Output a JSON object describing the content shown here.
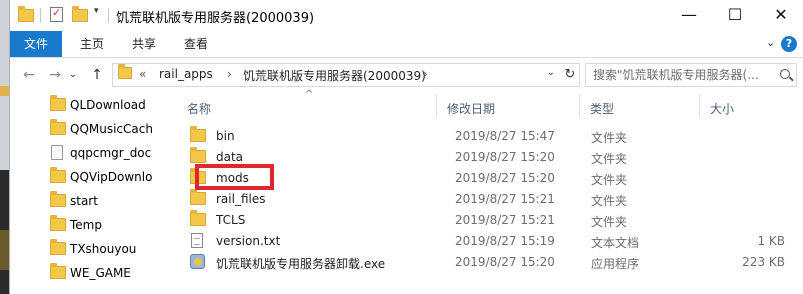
{
  "window": {
    "title": "饥荒联机版专用服务器(2000039)",
    "minimize": "—",
    "maximize": "☐",
    "close": "✕"
  },
  "ribbon": {
    "tabs": [
      "文件",
      "主页",
      "共享",
      "查看"
    ],
    "chevron": "⌄",
    "help": "?"
  },
  "nav": {
    "back": "←",
    "forward": "→",
    "recent": "⌄",
    "up": "↑",
    "crumbs": [
      "«",
      "rail_apps",
      "›",
      "饥荒联机版专用服务器(2000039)",
      "›"
    ],
    "addr_dropdown": "⌄",
    "refresh": "↻"
  },
  "search": {
    "placeholder": "搜索\"饥荒联机版专用服务器(..."
  },
  "sidebar": {
    "items": [
      {
        "label": "QLDownload",
        "icon": "folder-icon"
      },
      {
        "label": "QQMusicCach",
        "icon": "folder-icon"
      },
      {
        "label": "qqpcmgr_doc",
        "icon": "document-icon"
      },
      {
        "label": "QQVipDownlo",
        "icon": "folder-icon"
      },
      {
        "label": "start",
        "icon": "folder-icon"
      },
      {
        "label": "Temp",
        "icon": "folder-icon"
      },
      {
        "label": "TXshouyou",
        "icon": "folder-icon"
      },
      {
        "label": "WE_GAME",
        "icon": "folder-icon"
      }
    ]
  },
  "columns": {
    "name": "名称",
    "modified": "修改日期",
    "type": "类型",
    "size": "大小",
    "sort_indicator": "^"
  },
  "files": [
    {
      "name": "bin",
      "modified": "2019/8/27 15:47",
      "type": "文件夹",
      "size": "",
      "icon": "folder-icon"
    },
    {
      "name": "data",
      "modified": "2019/8/27 15:20",
      "type": "文件夹",
      "size": "",
      "icon": "folder-icon"
    },
    {
      "name": "mods",
      "modified": "2019/8/27 15:20",
      "type": "文件夹",
      "size": "",
      "icon": "folder-icon"
    },
    {
      "name": "rail_files",
      "modified": "2019/8/27 15:21",
      "type": "文件夹",
      "size": "",
      "icon": "folder-icon"
    },
    {
      "name": "TCLS",
      "modified": "2019/8/27 15:21",
      "type": "文件夹",
      "size": "",
      "icon": "folder-icon"
    },
    {
      "name": "version.txt",
      "modified": "2019/8/27 15:19",
      "type": "文本文档",
      "size": "1 KB",
      "icon": "text-file-icon"
    },
    {
      "name": "饥荒联机版专用服务器卸载.exe",
      "modified": "2019/8/27 15:20",
      "type": "应用程序",
      "size": "223 KB",
      "icon": "exe-icon"
    }
  ],
  "colors": {
    "accent": "#1979ca",
    "highlight_box": "#e3262d",
    "folder": "#f3c74a"
  }
}
